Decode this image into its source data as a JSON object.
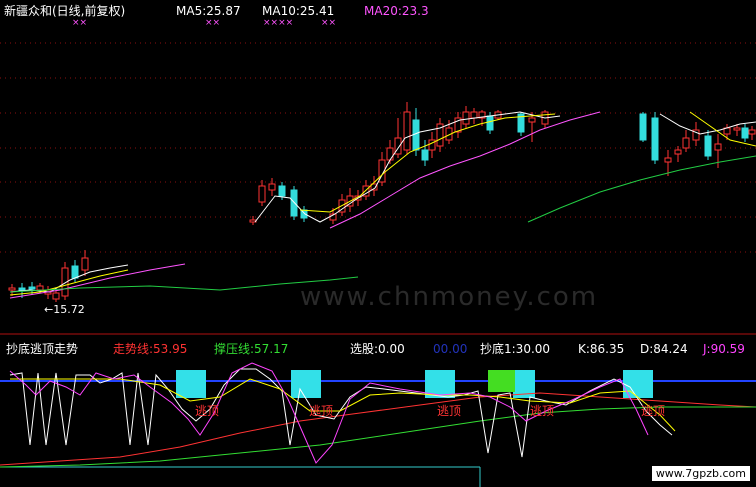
{
  "header": {
    "stock_name": "新疆众和(日线,前复权)",
    "ma5": "MA5:25.87",
    "ma10": "MA10:25.41",
    "ma20": "MA20:23.3",
    "marks": [
      "××",
      "××",
      "××××",
      "××"
    ]
  },
  "price_chart": {
    "low_marker": "←15.72",
    "watermark": "www.chnmoney.com"
  },
  "indicator": {
    "title": "抄底逃顶走势",
    "trend_line": "走势线:53.95",
    "pressure_line": "撑压线:57.17",
    "select_stock": "选股:0.00",
    "dark_value": "00.00",
    "bottom_value": "抄底1:30.00",
    "k_value": "K:86.35",
    "d_value": "D:84.24",
    "j_value": "J:90.59",
    "escape_labels": [
      "逃顶",
      "逃顶",
      "逃顶",
      "逃顶",
      "逃顶"
    ]
  },
  "watermark_site": "www.7gpzb.com",
  "colors": {
    "ma5": "#ffffff",
    "ma10": "#ffff00",
    "ma20": "#ff55ff",
    "long_ma": "#22cc44",
    "up_candle": "#ff3333",
    "down_candle": "#33dddd",
    "signal_box": "#33e0e8",
    "signal_green": "#44dd22",
    "trend": "#ff3333",
    "pressure": "#33dd33",
    "k_line": "#ffffff",
    "d_line": "#ffff00",
    "j_line": "#ff44ff",
    "blue_line": "#2244ff"
  }
}
